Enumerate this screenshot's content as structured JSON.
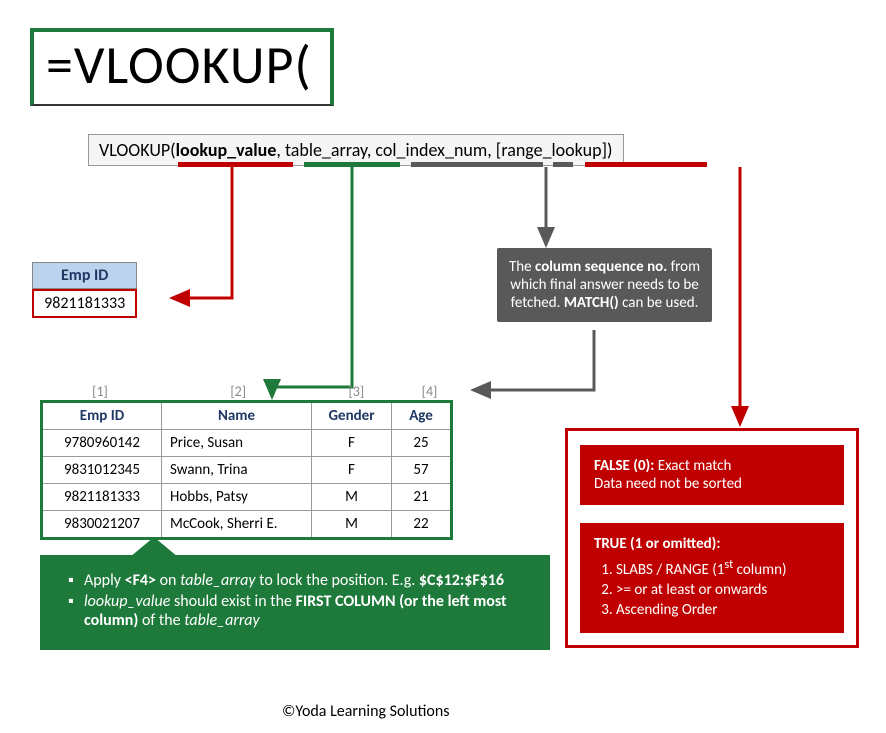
{
  "formula": "=VLOOKUP(",
  "tooltip": {
    "fn": "VLOOKUP(",
    "arg1": "lookup_value",
    "rest": ", table_array, col_index_num, [range_lookup])"
  },
  "empid": {
    "header": "Emp ID",
    "value": "9821181333"
  },
  "colnums": [
    "[1]",
    "[2]",
    "[3]",
    "[4]"
  ],
  "table": {
    "headers": [
      "Emp ID",
      "Name",
      "Gender",
      "Age"
    ],
    "rows": [
      [
        "9780960142",
        "Price, Susan",
        "F",
        "25"
      ],
      [
        "9831012345",
        "Swann, Trina",
        "F",
        "57"
      ],
      [
        "9821181333",
        "Hobbs, Patsy",
        "M",
        "21"
      ],
      [
        "9830021207",
        "McCook, Sherri E.",
        "M",
        "22"
      ]
    ]
  },
  "callout": {
    "l1a": "Apply ",
    "l1b": "<F4>",
    "l1c": " on ",
    "l1d": "table_array",
    "l1e": " to lock the position. E.g. ",
    "l1f": "$C$12:$F$16",
    "l2a": "lookup_value",
    "l2b": " should exist in the ",
    "l2c": "FIRST COLUMN (or the left most column)",
    "l2d": " of the ",
    "l2e": "table_array"
  },
  "graybox": {
    "t1": "The ",
    "t2": "column sequence no.",
    "t3": " from which final answer needs to be fetched. ",
    "t4": "MATCH()",
    "t5": " can be used."
  },
  "red": {
    "b1a": "FALSE (0):",
    "b1b": " Exact match",
    "b1c": "Data need not be sorted",
    "b2a": "TRUE (1 or omitted):",
    "b2i1a": "SLABS / RANGE (1",
    "b2i1b": "st",
    "b2i1c": " column)",
    "b2i2": ">= or at least or onwards",
    "b2i3": "Ascending Order"
  },
  "copyright": "©Yoda Learning Solutions"
}
